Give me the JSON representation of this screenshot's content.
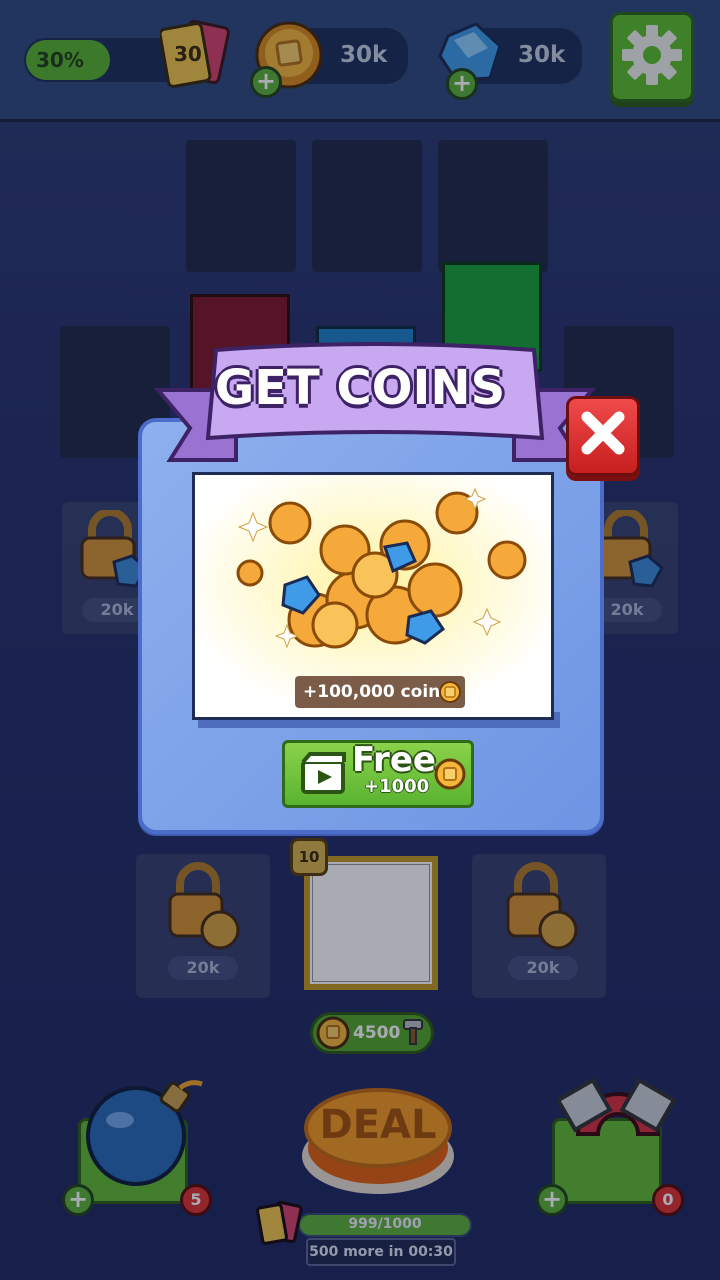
{
  "hud": {
    "progress_percent": 30,
    "progress_text": "30%",
    "cards_count": "30",
    "coins": "30k",
    "gems": "30k"
  },
  "board": {
    "lock_price_left_mid": "20k",
    "lock_price_right_mid": "20k",
    "lock_price_left_low": "20k",
    "lock_price_right_low": "20k",
    "target_level": "10",
    "deal_cost": "4500"
  },
  "modal": {
    "title": "GET COINS",
    "offer_amount": "+100,000 coins",
    "free_label": "Free",
    "free_bonus": "+1000"
  },
  "bottom": {
    "deal_label": "DEAL",
    "bomb_count": "5",
    "magnet_count": "0",
    "deal_progress_text": "999/1000",
    "deal_progress_value": 999,
    "deal_progress_max": 1000,
    "timer_text": "500 more in 00:30"
  }
}
